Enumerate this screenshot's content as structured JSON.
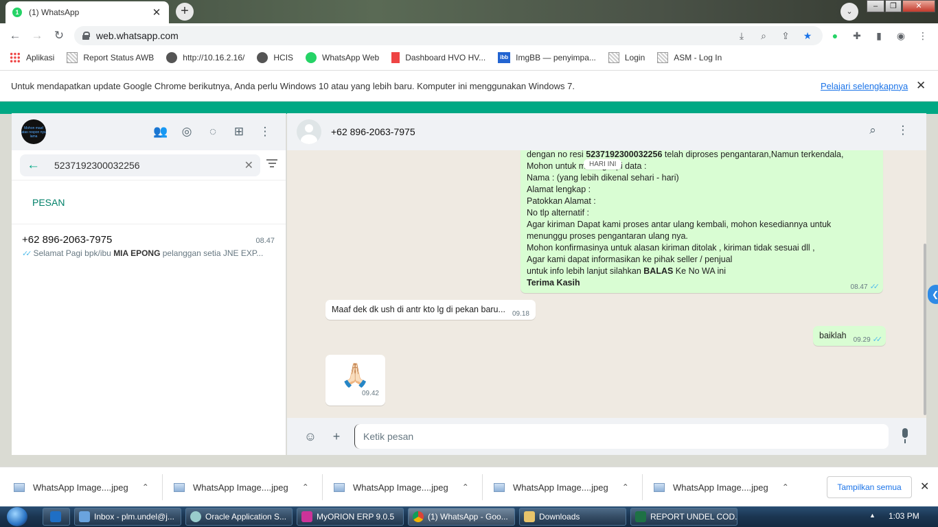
{
  "browser": {
    "tab_badge": "1",
    "tab_title": "(1) WhatsApp",
    "url": "web.whatsapp.com",
    "bookmarks": [
      "Aplikasi",
      "Report Status AWB",
      "http://10.16.2.16/",
      "HCIS",
      "WhatsApp Web",
      "Dashboard HVO HV...",
      "ImgBB — penyimpa...",
      "Login",
      "ASM - Log In"
    ],
    "infobar_text": "Untuk mendapatkan update Google Chrome berikutnya, Anda perlu Windows 10 atau yang lebih baru. Komputer ini menggunakan Windows 7.",
    "infobar_link": "Pelajari selengkapnya"
  },
  "left_panel": {
    "avatar_text": "Mohon maaf atas respon nya lama",
    "search_value": "5237192300032256",
    "section_label": "PESAN",
    "result": {
      "name": "+62 896-2063-7975",
      "time": "08.47",
      "snippet_pre": "Selamat Pagi  bpk/ibu ",
      "snippet_bold": "MIA EPONG",
      "snippet_post": " pelanggan setia JNE EXP..."
    }
  },
  "chat": {
    "contact": "+62 896-2063-7975",
    "day_pill": "HARI INI",
    "message_out_1": {
      "line1_pre": "dengan no resi ",
      "line1_bold": "5237192300032256",
      "line1_post": " telah diproses pengantaran,Namun terkendala,",
      "line2": "Mohon untuk melengkapi data :",
      "line3": "Nama : (yang lebih dikenal sehari - hari)",
      "line4": "Alamat  lengkap :",
      "line5": "Patokkan Alamat :",
      "line6": "No tlp alternatif :",
      "line7": "Agar kiriman Dapat kami proses antar ulang kembali, mohon kesediannya untuk",
      "line8": "menunggu proses pengantaran ulang nya.",
      "line9": "Mohon konfirmasinya untuk alasan kiriman ditolak , kiriman tidak sesuai dll ,",
      "line10": "Agar kami dapat informasikan ke pihak seller / penjual",
      "line11_pre": "untuk info lebih lanjut silahkan ",
      "line11_bold": "BALAS",
      "line11_post": " Ke No WA ini",
      "line12": "Terima Kasih",
      "time": "08.47"
    },
    "message_in_1": {
      "text": "Maaf dek dk ush di antr kto lg di pekan baru...",
      "time": "09.18"
    },
    "message_out_2": {
      "text": "baiklah",
      "time": "09.29"
    },
    "message_in_2": {
      "emoji": "🙏🏻",
      "time": "09.42"
    },
    "input_placeholder": "Ketik pesan"
  },
  "downloads": {
    "files": [
      "WhatsApp Image....jpeg",
      "WhatsApp Image....jpeg",
      "WhatsApp Image....jpeg",
      "WhatsApp Image....jpeg",
      "WhatsApp Image....jpeg"
    ],
    "show_all": "Tampilkan semua"
  },
  "taskbar": {
    "items": [
      "Inbox - plm.undel@j...",
      "Oracle Application S...",
      "MyORION ERP 9.0.5",
      "(1) WhatsApp - Goo...",
      "Downloads",
      "REPORT UNDEL COD..."
    ],
    "clock": "1:03 PM"
  },
  "colors": {
    "accent": "#00a884",
    "outgoing_bubble": "#d9fdd3",
    "chat_bg": "#efeae2",
    "link": "#1a73e8"
  }
}
